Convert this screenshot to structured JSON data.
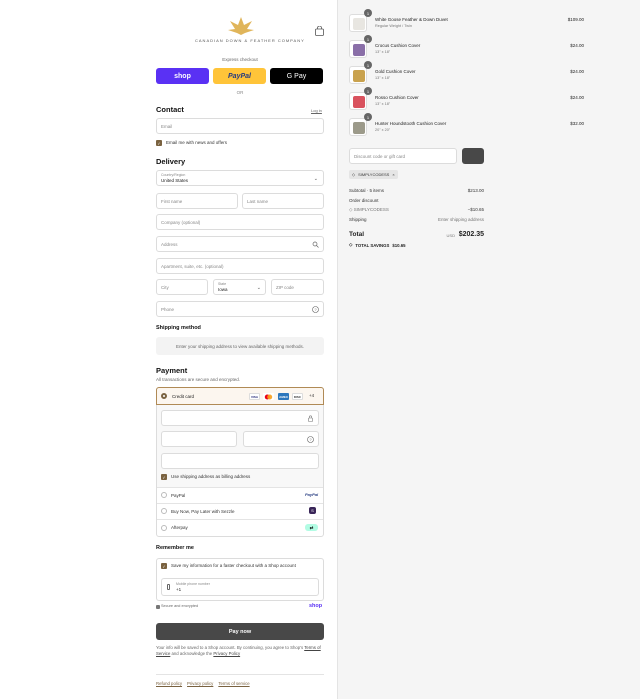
{
  "header": {
    "brand": "CANADIAN DOWN & FEATHER COMPANY",
    "express_label": "Express checkout",
    "or_label": "OR"
  },
  "express": {
    "shop": "shop",
    "paypal": "PayPal",
    "gpay": "G Pay"
  },
  "contact": {
    "heading": "Contact",
    "login": "Log in",
    "email_placeholder": "Email",
    "news_label": "Email me with news and offers"
  },
  "delivery": {
    "heading": "Delivery",
    "country_label": "Country/Region",
    "country_value": "United States",
    "first_name": "First name",
    "last_name": "Last name",
    "company": "Company (optional)",
    "address": "Address",
    "apartment": "Apartment, suite, etc. (optional)",
    "city": "City",
    "state_label": "State",
    "state_value": "Iowa",
    "zip": "ZIP code",
    "phone": "Phone"
  },
  "shipping": {
    "heading": "Shipping method",
    "note": "Enter your shipping address to view available shipping methods."
  },
  "payment": {
    "heading": "Payment",
    "subtitle": "All transactions are secure and encrypted.",
    "credit_card": "Credit card",
    "more_cards": "+4",
    "billing_label": "Use shipping address as billing address",
    "paypal": "PayPal",
    "sezzle": "Buy Now, Pay Later with Sezzle",
    "afterpay": "Afterpay"
  },
  "remember": {
    "heading": "Remember me",
    "save_label": "Save my information for a faster checkout with a Shop account",
    "mobile_label": "Mobile phone number",
    "mobile_value": "+1",
    "secure": "Secure and encrypted",
    "shop": "shop"
  },
  "pay_now": "Pay now",
  "legal": {
    "text": "Your info will be saved to a Shop account. By continuing, you agree to Shop's",
    "terms": "Terms of Service",
    "and": "and acknowledge the",
    "privacy": "Privacy Policy"
  },
  "footer": {
    "refund": "Refund policy",
    "privacy": "Privacy policy",
    "terms": "Terms of service"
  },
  "cart": {
    "items": [
      {
        "qty": "1",
        "name": "White Goose Feather & Down Duvet",
        "variant": "Regular Weight / Twin",
        "price": "$109.00",
        "color": "#e8e6e1"
      },
      {
        "qty": "1",
        "name": "Crocus Cushion Cover",
        "variant": "13\" x 18\"",
        "price": "$24.00",
        "color": "#8a6fa8"
      },
      {
        "qty": "1",
        "name": "Gold Cushion Cover",
        "variant": "13\" x 18\"",
        "price": "$24.00",
        "color": "#c9a24e"
      },
      {
        "qty": "1",
        "name": "Rosso Cushion Cover",
        "variant": "13\" x 18\"",
        "price": "$24.00",
        "color": "#d9525e"
      },
      {
        "qty": "1",
        "name": "Hunter Houndstooth Cushion Cover",
        "variant": "20\" x 20\"",
        "price": "$32.00",
        "color": "#9c9a8a"
      }
    ],
    "discount_placeholder": "Discount code or gift card",
    "code_tag": "SIMPLYCODESS",
    "subtotal_label": "Subtotal · 5 items",
    "subtotal_value": "$213.00",
    "order_discount_label": "Order discount",
    "code_line": "SIMPLYCODESS",
    "discount_value": "−$10.65",
    "shipping_label": "Shipping",
    "shipping_value": "Enter shipping address",
    "total_label": "Total",
    "currency": "USD",
    "total_value": "$202.35",
    "savings_label": "TOTAL SAVINGS",
    "savings_value": "$10.65"
  }
}
